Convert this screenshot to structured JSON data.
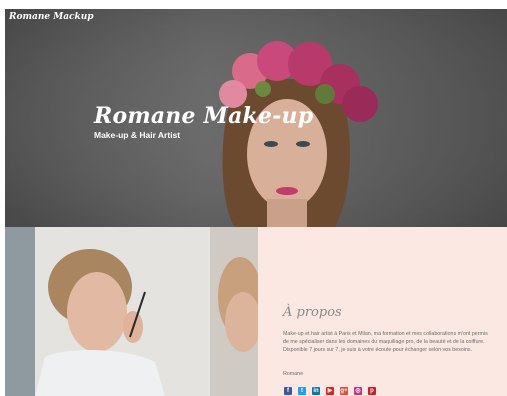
{
  "site": {
    "title": "Romane Mackup"
  },
  "hero": {
    "heading": "Romane Make-up",
    "subheading": "Make-up & Hair Artist"
  },
  "about": {
    "title": "À propos",
    "text": "Make-up et hair artist à Paris et Milan, ma formation et mes collaborations m'ont permis de me spécialiser dans les domaines du maquillage pro, de la beauté et de la coiffure. Disponible 7 jours sur 7, je suis à votre écoute pour échanger selon vos besoins.",
    "signature": "Romane"
  },
  "socials": [
    {
      "icon": "facebook-icon",
      "glyph": "f",
      "color": "#3b5998"
    },
    {
      "icon": "twitter-icon",
      "glyph": "t",
      "color": "#1da1f2"
    },
    {
      "icon": "linkedin-icon",
      "glyph": "in",
      "color": "#0e76a8"
    },
    {
      "icon": "youtube-icon",
      "glyph": "▶",
      "color": "#e62117"
    },
    {
      "icon": "google-plus-icon",
      "glyph": "g+",
      "color": "#dd4b39"
    },
    {
      "icon": "instagram-icon",
      "glyph": "◎",
      "color": "#c13584"
    },
    {
      "icon": "pinterest-icon",
      "glyph": "p",
      "color": "#cb2027"
    }
  ]
}
